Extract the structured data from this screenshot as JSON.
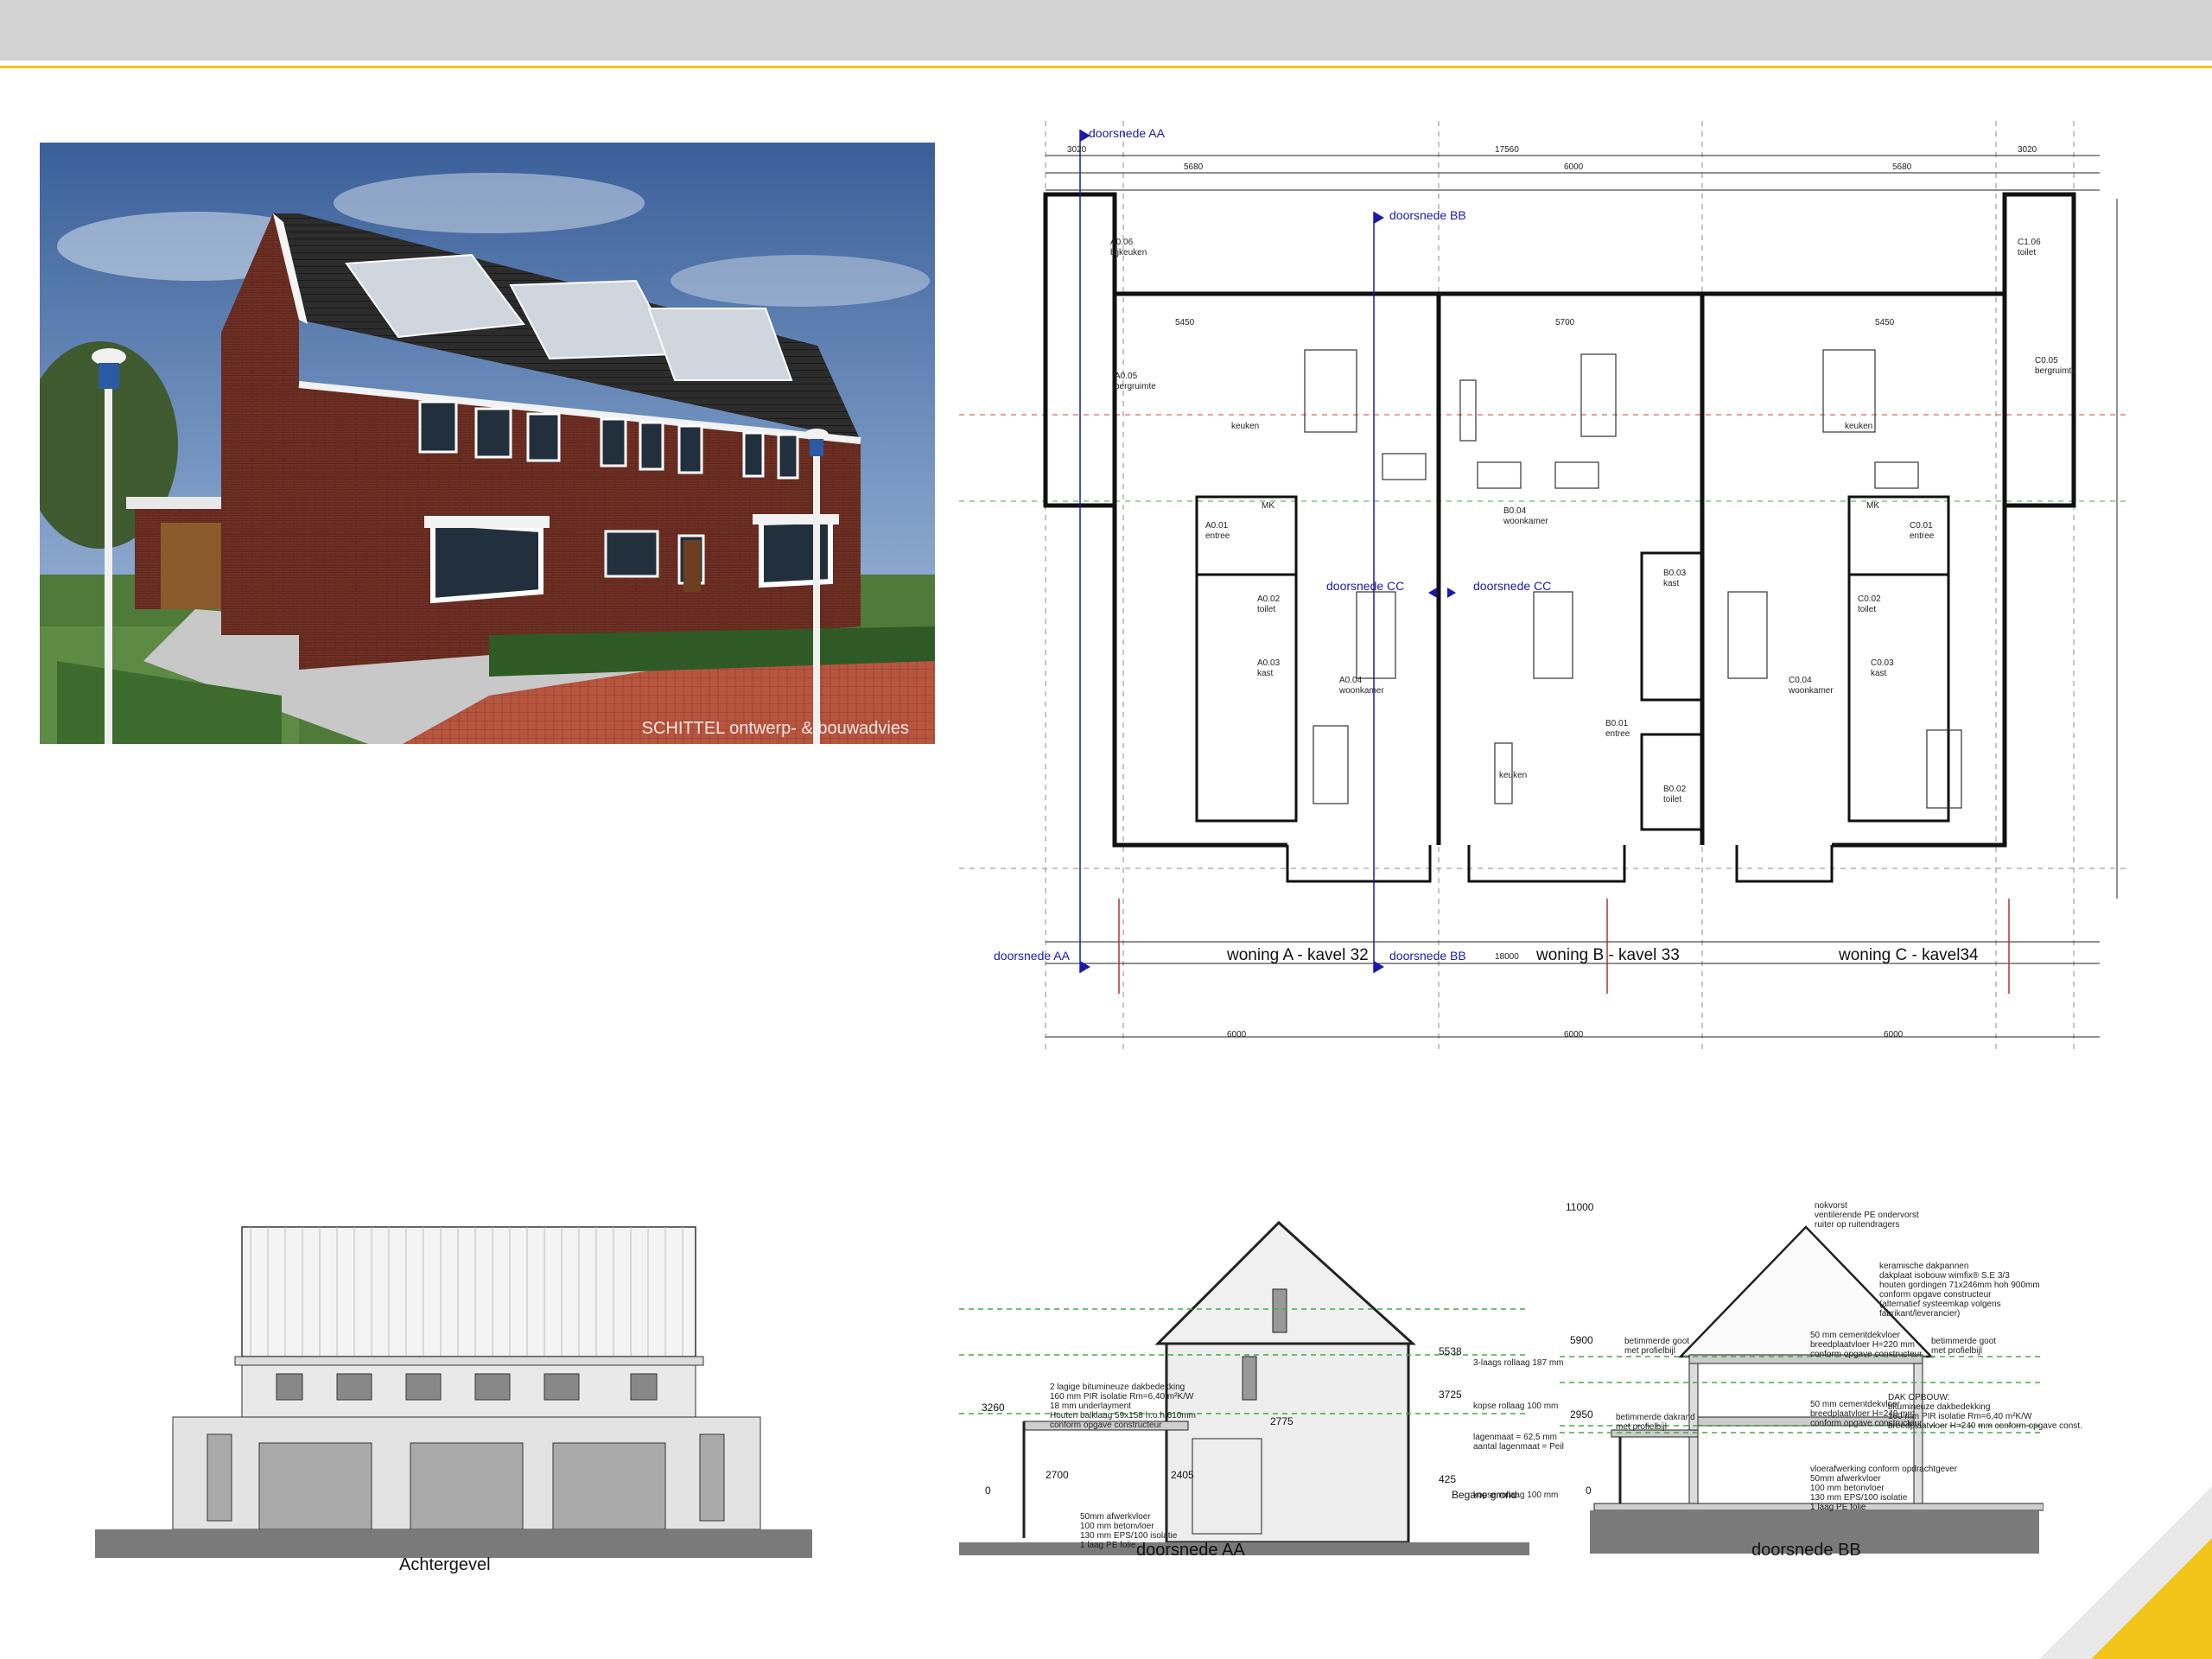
{
  "header": {
    "accent_color": "#f2c318",
    "bar_color": "#d3d3d3"
  },
  "photo": {
    "credit": "SCHITTEL ontwerp- & bouwadvies"
  },
  "plan": {
    "sections": {
      "aa_top": "doorsnede AA",
      "bb_top": "doorsnede BB",
      "cc_left": "doorsnede CC",
      "cc_right": "doorsnede CC",
      "aa_bottom": "doorsnede AA",
      "bb_bottom": "doorsnede BB"
    },
    "rooms": {
      "a06": "A0.06",
      "a06_name": "bijkeuken",
      "a05": "A0.05",
      "a05_name": "bergruimte",
      "a_keuken": "keuken",
      "a01": "A0.01",
      "a01_name": "entree",
      "a_mk": "MK",
      "a02": "A0.02",
      "a02_name": "toilet",
      "a03": "A0.03",
      "a03_name": "kast",
      "a04": "A0.04",
      "a04_name": "woonkamer",
      "b04": "B0.04",
      "b04_name": "woonkamer",
      "b03": "B0.03",
      "b03_name": "kast",
      "b01": "B0.01",
      "b01_name": "entree",
      "b02": "B0.02",
      "b02_name": "toilet",
      "b_keuken": "keuken",
      "c06": "C1.06",
      "c06_name": "toilet",
      "c05": "C0.05",
      "c05_name": "bergruimte",
      "c_keuken": "keuken",
      "c_mk": "MK",
      "c01": "C0.01",
      "c01_name": "entree",
      "c02": "C0.02",
      "c02_name": "toilet",
      "c03": "C0.03",
      "c03_name": "kast",
      "c04": "C0.04",
      "c04_name": "woonkamer"
    },
    "dims": {
      "total_top": "17560",
      "total_bottom": "18000",
      "w_a": "6000",
      "w_b": "6000",
      "w_c": "6000",
      "d1": "5680",
      "d2": "6000",
      "d3": "5680",
      "d4": "3020",
      "d5": "3020",
      "d6": "5450",
      "d7": "5700",
      "d8": "5450"
    },
    "kavels": {
      "a": "woning A - kavel 32",
      "b": "woning B - kavel 33",
      "c": "woning C - kavel34"
    }
  },
  "elevations": {
    "achtergevel": "Achtergevel",
    "doorsnede_aa": "doorsnede AA",
    "doorsnede_bb": "doorsnede BB",
    "aa_levels": [
      "5538",
      "3725",
      "3260",
      "2775",
      "425",
      "0",
      "2700",
      "2405"
    ],
    "aa_level_notes": [
      "3-laags rollaag 187 mm",
      "kopse rollaag 100 mm",
      "lagenmaat = 62,5 mm\naantal lagenmaat = Peil",
      "kopse rollaag 100 mm"
    ],
    "aa_roof_note": "2 lagige bitumineuze dakbedekking\n160 mm PIR isolatie Rm=6,40 m²K/W\n18 mm underlayment\nHouten balklaag 59x158 h.o.h 610mm\nconform opgave constructeur",
    "aa_floor_note": "50mm afwerkvloer\n100 mm betonvloer\n130 mm EPS/100 isolatie\n1 laag PE folie",
    "aa_ground": "Begane grond",
    "bb_levels": [
      "11000",
      "5900",
      "2950",
      "0"
    ],
    "bb_notes": {
      "ridge": "nokvorst\nventilerende PE ondervorst\nruiter op ruitendragers",
      "roof": "keramische dakpannen\ndakplaat isobouw wimfix® S.E 3/3\nhouten gordingen 71x246mm hoh 900mm\nconform opgave constructeur\n(alternatief systeemkap volgens\nfabrikant/leverancier)",
      "gutter_l": "betimmerde goot\nmet profielbijl",
      "gutter_r": "betimmerde goot\nmet profielbijl",
      "floor1": "50 mm cementdekvloer\nbreedplaatvloer H=220 mm\nconform opgave constructeur",
      "floor0": "50 mm cementdekvloer\nbreedplaatvloer H=240 mm\nconform opgave constructeur",
      "dak_opbouw": "DAK OPBOUW:\nbitumineuze dakbedekking\n160 mm PIR isolatie Rm=6,40 m²K/W\nbreedplaatvloer H=240 mm conform opgave const.",
      "canopy": "betimmerde dakrand\nmet profielbijl",
      "ground": "vloerafwerking conform opdrachtgever\n50mm afwerkvloer\n100 mm betonvloer\n130 mm EPS/100 isolatie\n1 laag PE folie"
    }
  }
}
